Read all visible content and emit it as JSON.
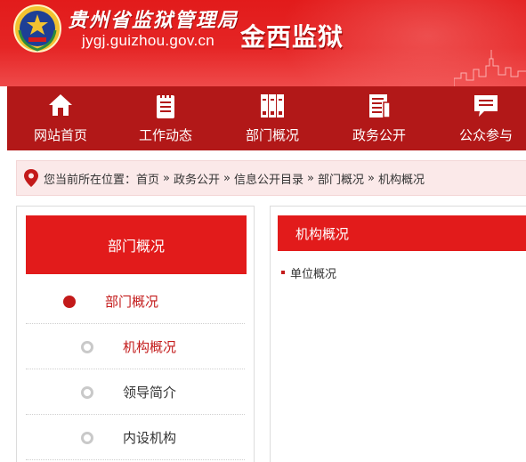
{
  "header": {
    "agency_name": "贵州省监狱管理局",
    "domain": "jygj.guizhou.gov.cn",
    "site_name": "金西监狱"
  },
  "nav": [
    {
      "label": "网站首页",
      "icon": "home-icon"
    },
    {
      "label": "工作动态",
      "icon": "notepad-icon"
    },
    {
      "label": "部门概况",
      "icon": "binders-icon"
    },
    {
      "label": "政务公开",
      "icon": "document-icon"
    },
    {
      "label": "公众参与",
      "icon": "chat-icon"
    }
  ],
  "breadcrumb": {
    "prefix": "您当前所在位置：",
    "items": [
      "首页",
      "政务公开",
      "信息公开目录",
      "部门概况",
      "机构概况"
    ],
    "separator": "»"
  },
  "sidebar": {
    "title": "部门概况",
    "items": [
      {
        "label": "部门概况",
        "level": "main"
      },
      {
        "label": "机构概况",
        "level": "sub",
        "active": true
      },
      {
        "label": "领导简介",
        "level": "sub"
      },
      {
        "label": "内设机构",
        "level": "sub"
      }
    ]
  },
  "content": {
    "title": "机构概况",
    "items": [
      "单位概况"
    ]
  },
  "colors": {
    "brand_red": "#e21b1b",
    "nav_red": "#b21818",
    "breadcrumb_bg": "#fbe9e9",
    "accent_text": "#c31a1a"
  }
}
